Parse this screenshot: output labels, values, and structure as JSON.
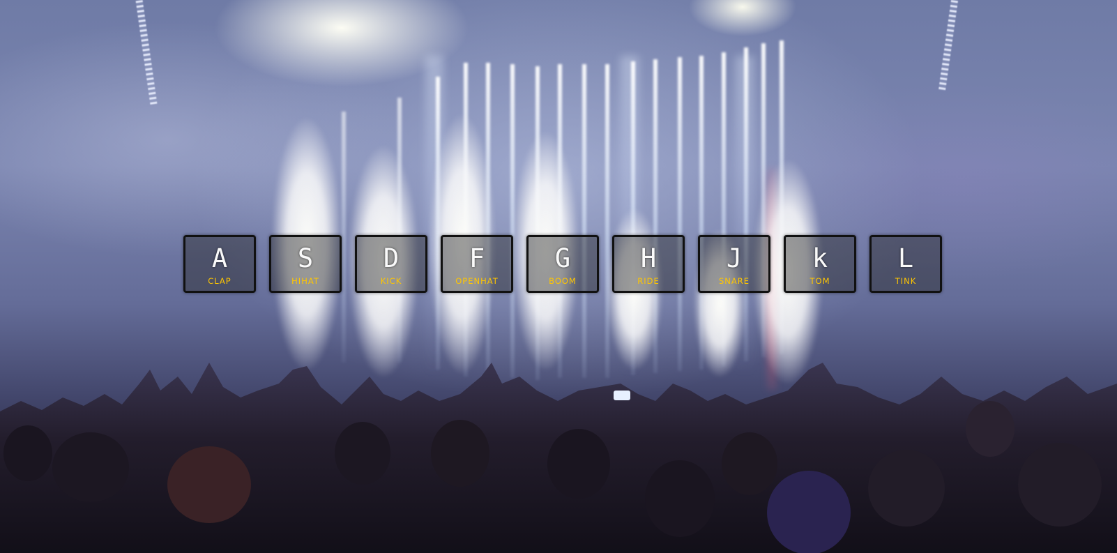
{
  "background": {
    "scene": "concert-crowd-stage-photo"
  },
  "colors": {
    "key_border": "#111111",
    "key_letter": "#fafafa",
    "key_sound_label": "#ffc600"
  },
  "keys": [
    {
      "letter": "A",
      "sound": "CLAP"
    },
    {
      "letter": "S",
      "sound": "HIHAT"
    },
    {
      "letter": "D",
      "sound": "KICK"
    },
    {
      "letter": "F",
      "sound": "OPENHAT"
    },
    {
      "letter": "G",
      "sound": "BOOM"
    },
    {
      "letter": "H",
      "sound": "RIDE"
    },
    {
      "letter": "J",
      "sound": "SNARE"
    },
    {
      "letter": "k",
      "sound": "TOM"
    },
    {
      "letter": "L",
      "sound": "TINK"
    }
  ]
}
